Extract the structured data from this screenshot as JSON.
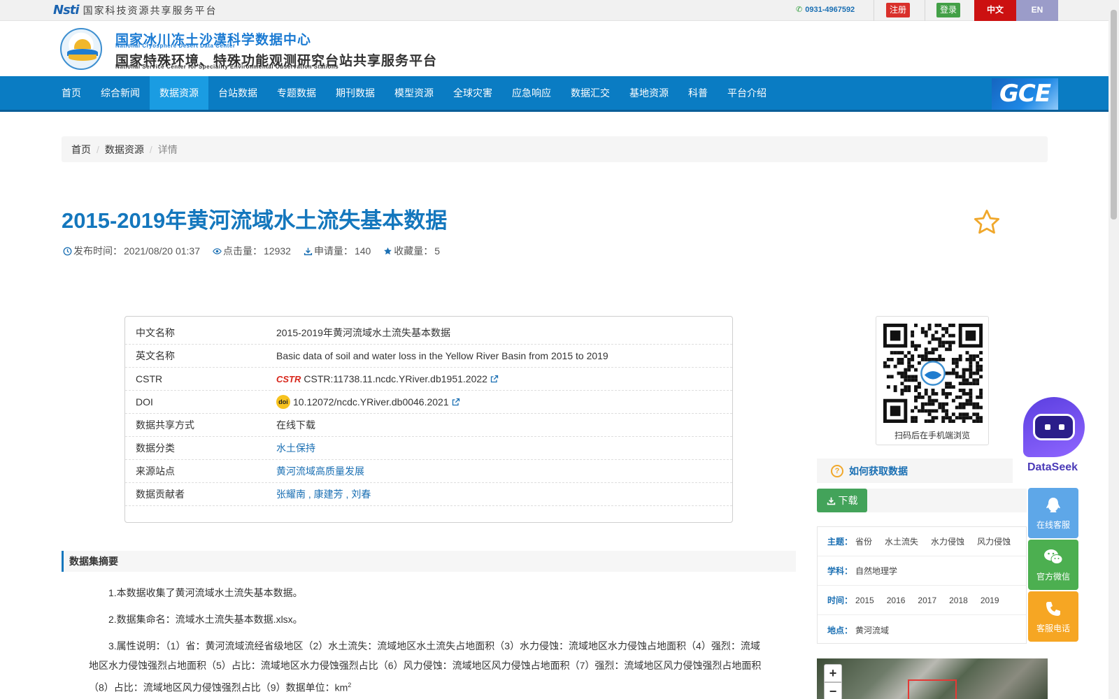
{
  "topbar": {
    "brand_logo": "Nsti",
    "brand_text": "国家科技资源共享服务平台",
    "phone": "0931-4967592",
    "register": "注册",
    "login": "登录",
    "lang_zh": "中文",
    "lang_en": "EN"
  },
  "header": {
    "title_cn": "国家冰川冻土沙漠科学数据中心",
    "title_en": "National Cryosphere Desert Data Center",
    "platform_cn": "国家特殊环境、特殊功能观测研究台站共享服务平台",
    "platform_en": "National Service Center for Speciality Environmental Observation Stations"
  },
  "nav": {
    "items": [
      "首页",
      "综合新闻",
      "数据资源",
      "台站数据",
      "专题数据",
      "期刊数据",
      "模型资源",
      "全球灾害",
      "应急响应",
      "数据汇交",
      "基地资源",
      "科普",
      "平台介绍"
    ],
    "active": "数据资源",
    "gce_logo": "GCE"
  },
  "breadcrumb": {
    "home": "首页",
    "section": "数据资源",
    "current": "详情"
  },
  "dataset": {
    "title": "2015-2019年黄河流域水土流失基本数据",
    "publish_label": "发布时间：",
    "publish_time": "2021/08/20 01:37",
    "views_label": "点击量：",
    "views": "12932",
    "requests_label": "申请量：",
    "requests": "140",
    "favorites_label": "收藏量：",
    "favorites": "5"
  },
  "info": {
    "rows": [
      {
        "k": "中文名称",
        "v": "2015-2019年黄河流域水土流失基本数据"
      },
      {
        "k": "英文名称",
        "v": "Basic data of soil and water loss in the Yellow River Basin from 2015 to 2019"
      },
      {
        "k": "CSTR",
        "v": "CSTR:11738.11.ncdc.YRiver.db1951.2022",
        "logo": "CSTR"
      },
      {
        "k": "DOI",
        "v": "10.12072/ncdc.YRiver.db0046.2021",
        "logo": "doi"
      },
      {
        "k": "数据共享方式",
        "v": "在线下载"
      },
      {
        "k": "数据分类",
        "v": "水土保持"
      },
      {
        "k": "来源站点",
        "v": "黄河流域高质量发展"
      },
      {
        "k": "数据贡献者",
        "v": "张耀南 , 康建芳 , 刘春"
      }
    ]
  },
  "qr": {
    "caption": "扫码后在手机端浏览"
  },
  "dataseek": {
    "label": "DataSeek"
  },
  "sidebar": {
    "how_to": "如何获取数据",
    "download": "下载",
    "tags": [
      {
        "k": "主题：",
        "values": [
          "省份",
          "水土流失",
          "水力侵蚀",
          "风力侵蚀"
        ]
      },
      {
        "k": "学科：",
        "values": [
          "自然地理学"
        ]
      },
      {
        "k": "时间：",
        "values": [
          "2015",
          "2016",
          "2017",
          "2018",
          "2019"
        ]
      },
      {
        "k": "地点：",
        "values": [
          "黄河流域"
        ]
      }
    ]
  },
  "float": {
    "qq": "在线客服",
    "wechat": "官方微信",
    "phone": "客服电话"
  },
  "abstract": {
    "heading": "数据集摘要",
    "p1": "1.本数据收集了黄河流域水土流失基本数据。",
    "p2": "2.数据集命名：流域水土流失基本数据.xlsx。",
    "p3": "3.属性说明：（1）省：黄河流域流经省级地区（2）水土流失：流域地区水土流失占地面积（3）水力侵蚀：流域地区水力侵蚀占地面积（4）强烈：流域地区水力侵蚀强烈占地面积（5）占比：流域地区水力侵蚀强烈占比（6）风力侵蚀：流域地区风力侵蚀占地面积（7）强烈：流域地区风力侵蚀强烈占地面积（8）占比：流域地区风力侵蚀强烈占比（9）数据单位：km",
    "p3_sup": "2"
  },
  "map": {
    "zoom_in": "+",
    "zoom_out": "−"
  },
  "colors": {
    "brand_blue": "#0a7cc3",
    "title_blue": "#1477bd",
    "active_nav": "#1a9ce2",
    "download_green": "#43a35a"
  }
}
